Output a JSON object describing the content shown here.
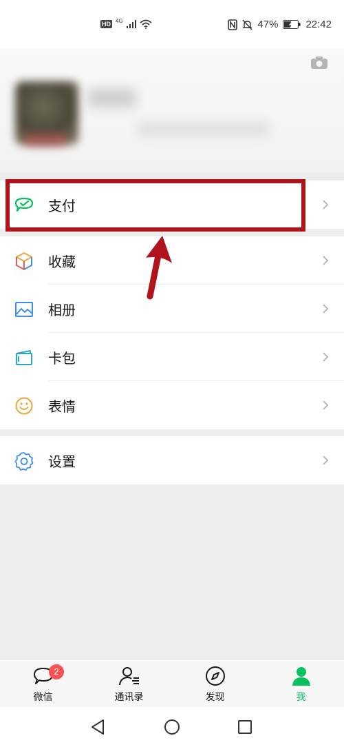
{
  "status_bar": {
    "hd": "HD",
    "network": "4G",
    "battery": "47%",
    "time": "22:42"
  },
  "menu": {
    "pay": "支付",
    "favorites": "收藏",
    "album": "相册",
    "cards": "卡包",
    "stickers": "表情",
    "settings": "设置"
  },
  "tabbar": {
    "chats": "微信",
    "chats_badge": "2",
    "contacts": "通讯录",
    "discover": "发现",
    "me": "我"
  },
  "colors": {
    "accent": "#07c160",
    "highlight": "#b0141a",
    "badge": "#fa5151"
  }
}
